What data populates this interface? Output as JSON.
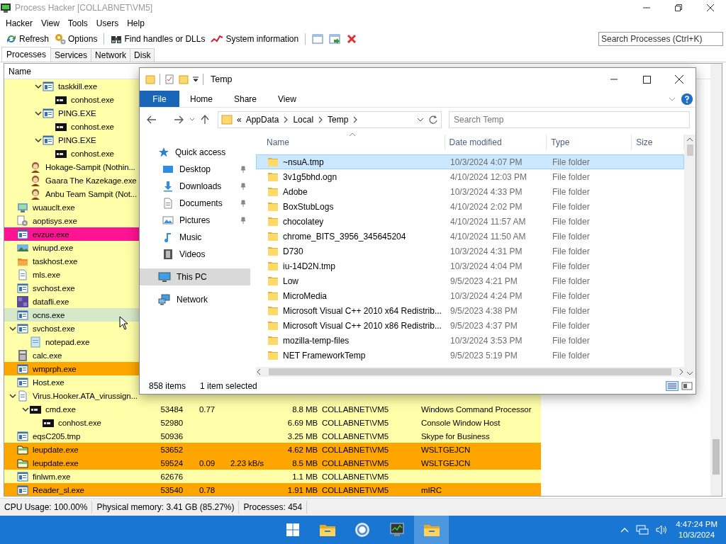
{
  "process_hacker": {
    "title": "Process Hacker [COLLABNET\\VM5]",
    "menu": [
      "Hacker",
      "View",
      "Tools",
      "Users",
      "Help"
    ],
    "toolbar": [
      {
        "kind": "refresh",
        "label": "Refresh"
      },
      {
        "kind": "options",
        "label": "Options"
      },
      {
        "kind": "separator"
      },
      {
        "kind": "find",
        "label": "Find handles or DLLs"
      },
      {
        "kind": "sysinfo",
        "label": "System information"
      },
      {
        "kind": "separator"
      },
      {
        "kind": "window"
      },
      {
        "kind": "window-go"
      },
      {
        "kind": "close"
      }
    ],
    "search": {
      "placeholder": "Search Processes (Ctrl+K)"
    },
    "tabs": [
      {
        "label": "Processes",
        "selected": true
      },
      {
        "label": "Services",
        "selected": false
      },
      {
        "label": "Network",
        "selected": false
      },
      {
        "label": "Disk",
        "selected": false
      }
    ],
    "columns": [
      "Name"
    ],
    "processes": [
      {
        "children": [
          {
            "children": [
              {
                "name": "taskkill.exe",
                "kind": "window",
                "color": "#ffffaa",
                "children": [
                  {
                    "name": "conhost.exe",
                    "kind": "console",
                    "color": "#ffffaa"
                  }
                ]
              },
              {
                "name": "PING.EXE",
                "kind": "window",
                "color": "#ffffaa",
                "children": [
                  {
                    "name": "conhost.exe",
                    "kind": "console",
                    "color": "#ffffaa"
                  }
                ]
              },
              {
                "name": "PING.EXE",
                "kind": "window",
                "color": "#ffffaa",
                "children": [
                  {
                    "name": "conhost.exe",
                    "kind": "console",
                    "color": "#ffffaa"
                  }
                ]
              }
            ]
          },
          {
            "name": "Hokage-Sampit (Nothin...",
            "kind": "avatar",
            "color": "#ffffaa"
          },
          {
            "name": "Gaara The Kazekage.exe",
            "kind": "avatar",
            "color": "#ffffaa"
          },
          {
            "name": "Anbu Team Sampit (Not...",
            "kind": "avatar",
            "color": "#ffffaa"
          }
        ]
      },
      {
        "name": "wuauclt.exe",
        "kind": "installer",
        "color": "#ffffaa"
      },
      {
        "name": "aoptisys.exe",
        "kind": "gear",
        "color": "#ffffaa"
      },
      {
        "name": "evzue.exe",
        "kind": "window",
        "color": "#ff1493"
      },
      {
        "name": "winupd.exe",
        "kind": "landscape",
        "color": "#ffffaa"
      },
      {
        "name": "taskhost.exe",
        "kind": "folder",
        "color": "#ffffaa"
      },
      {
        "name": "mls.exe",
        "kind": "document",
        "color": "#ffffaa"
      },
      {
        "name": "svchost.exe",
        "kind": "window",
        "color": "#ffffaa"
      },
      {
        "name": "datafli.exe",
        "kind": "grid",
        "color": "#ffffaa"
      },
      {
        "name": "ocns.exe",
        "kind": "window",
        "color": "#d5e8c8"
      },
      {
        "name": "svchost.exe",
        "kind": "window",
        "color": "#ffffaa",
        "children": [
          {
            "name": "notepad.exe",
            "kind": "notepad",
            "color": "#ffffaa"
          }
        ]
      },
      {
        "name": "calc.exe",
        "kind": "calculator",
        "color": "#ffffaa"
      },
      {
        "name": "wmprph.exe",
        "kind": "window",
        "color": "#ffa500"
      },
      {
        "name": "Host.exe",
        "kind": "window",
        "color": "#ffffaa"
      },
      {
        "name": "Virus.Hooker.ATA_virussign...",
        "kind": "document",
        "color": "#ffffaa",
        "children": [
          {
            "name": "cmd.exe",
            "kind": "console",
            "color": "#ffffaa",
            "pid": "53484",
            "cpu": "0.77",
            "private": "8.8 MB",
            "user": "COLLABNET\\VM5",
            "description": "Windows Command Processor",
            "children": [
              {
                "name": "conhost.exe",
                "kind": "console",
                "color": "#ffffaa",
                "pid": "52980",
                "private": "6.69 MB",
                "user": "COLLABNET\\VM5",
                "description": "Console Window Host"
              }
            ]
          }
        ]
      },
      {
        "name": "eqsC205.tmp",
        "kind": "window",
        "color": "#ffffaa",
        "pid": "50936",
        "private": "3.25 MB",
        "user": "COLLABNET\\VM5",
        "description": "Skype for Business"
      },
      {
        "name": "leupdate.exe",
        "kind": "package",
        "color": "#ffa500",
        "pid": "53652",
        "private": "4.62 MB",
        "user": "COLLABNET\\VM5",
        "description": "WSLTGEJCN"
      },
      {
        "name": "leupdate.exe",
        "kind": "package",
        "color": "#ffa500",
        "pid": "59524",
        "cpu": "0.09",
        "io": "2.23 kB/s",
        "private": "8.5 MB",
        "user": "COLLABNET\\VM5",
        "description": "WSLTGEJCN"
      },
      {
        "name": "finlwm.exe",
        "kind": "window",
        "color": "#ffffaa",
        "pid": "62676",
        "private": "1.1 MB",
        "user": "COLLABNET\\VM5"
      },
      {
        "name": "Reader_sl.exe",
        "kind": "window",
        "color": "#ffa500",
        "pid": "53540",
        "cpu": "0.78",
        "private": "1.91 MB",
        "user": "COLLABNET\\VM5",
        "description": "mIRC"
      }
    ],
    "status_bar": [
      "CPU Usage: 100.00%",
      "Physical memory: 3.41 GB (85.27%)",
      "Processes: 454"
    ]
  },
  "explorer": {
    "title": "Temp",
    "ribbon": [
      {
        "label": "File",
        "kind": "file"
      },
      {
        "label": "Home",
        "kind": "tab"
      },
      {
        "label": "Share",
        "kind": "tab"
      },
      {
        "label": "View",
        "kind": "tab"
      }
    ],
    "address_overflow": "«",
    "address": [
      "AppData",
      "Local",
      "Temp"
    ],
    "search": {
      "placeholder": "Search Temp"
    },
    "nav": [
      {
        "label": "Quick access",
        "kind": "star",
        "selected": false,
        "children": [
          {
            "label": "Desktop",
            "kind": "desktop",
            "pinned": true,
            "selected": false
          },
          {
            "label": "Downloads",
            "kind": "download",
            "pinned": true,
            "selected": false
          },
          {
            "label": "Documents",
            "kind": "documents",
            "pinned": true,
            "selected": false
          },
          {
            "label": "Pictures",
            "kind": "pictures",
            "pinned": true,
            "selected": false
          },
          {
            "label": "Music",
            "kind": "music",
            "pinned": false,
            "selected": false
          },
          {
            "label": "Videos",
            "kind": "videos",
            "pinned": false,
            "selected": false
          }
        ]
      },
      {
        "label": "This PC",
        "kind": "pc",
        "selected": true
      },
      {
        "label": "Network",
        "kind": "network",
        "selected": false
      }
    ],
    "columns": [
      "Name",
      "Date modified",
      "Type",
      "Size"
    ],
    "files": [
      {
        "name": "~nsuA.tmp",
        "date": "10/3/2024 4:07 PM",
        "type": "File folder",
        "selected": true
      },
      {
        "name": "3v1g5bhd.ogn",
        "date": "4/10/2024 12:03 PM",
        "type": "File folder",
        "selected": false
      },
      {
        "name": "Adobe",
        "date": "10/3/2024 4:33 PM",
        "type": "File folder",
        "selected": false
      },
      {
        "name": "BoxStubLogs",
        "date": "4/10/2024 2:02 PM",
        "type": "File folder",
        "selected": false
      },
      {
        "name": "chocolatey",
        "date": "4/10/2024 11:57 AM",
        "type": "File folder",
        "selected": false
      },
      {
        "name": "chrome_BITS_3956_345645204",
        "date": "4/10/2024 11:50 AM",
        "type": "File folder",
        "selected": false
      },
      {
        "name": "D730",
        "date": "10/3/2024 4:31 PM",
        "type": "File folder",
        "selected": false
      },
      {
        "name": "iu-14D2N.tmp",
        "date": "10/3/2024 4:04 PM",
        "type": "File folder",
        "selected": false
      },
      {
        "name": "Low",
        "date": "9/5/2023 4:21 PM",
        "type": "File folder",
        "selected": false
      },
      {
        "name": "MicroMedia",
        "date": "10/3/2024 4:24 PM",
        "type": "File folder",
        "selected": false
      },
      {
        "name": "Microsoft Visual C++ 2010 x64 Redistrib...",
        "date": "9/5/2023 4:38 PM",
        "type": "File folder",
        "selected": false
      },
      {
        "name": "Microsoft Visual C++ 2010 x86 Redistrib...",
        "date": "9/5/2023 4:37 PM",
        "type": "File folder",
        "selected": false
      },
      {
        "name": "mozilla-temp-files",
        "date": "10/3/2024 3:53 PM",
        "type": "File folder",
        "selected": false
      },
      {
        "name": "NET FrameworkTemp",
        "date": "9/5/2023 5:19 PM",
        "type": "File folder",
        "selected": false
      }
    ],
    "status": [
      "858 items",
      "1 item selected"
    ]
  },
  "taskbar": {
    "apps": [
      {
        "kind": "start",
        "active": false
      },
      {
        "kind": "explorer",
        "active": false
      },
      {
        "kind": "browser",
        "active": false
      },
      {
        "kind": "monitor",
        "active": false
      },
      {
        "kind": "explorer",
        "active": true
      }
    ],
    "time": "4:47:24 PM",
    "date": "10/3/2024"
  }
}
